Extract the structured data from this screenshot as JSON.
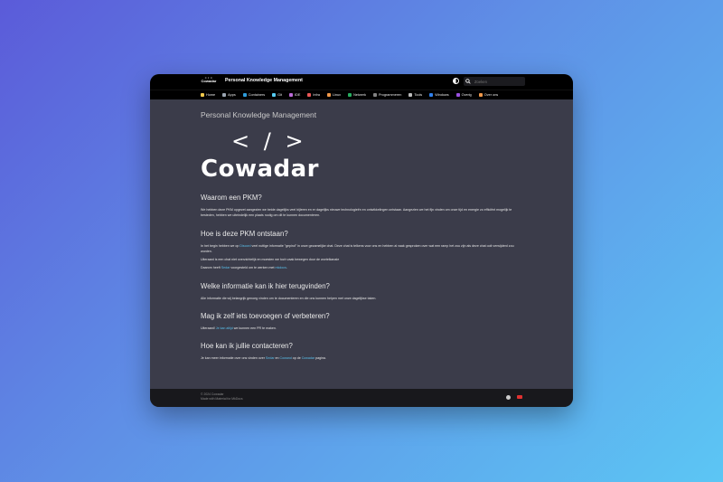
{
  "header": {
    "logo_code": "< / >",
    "logo_text": "Cowadar",
    "site_title": "Personal Knowledge Management",
    "search_placeholder": "Zoeken"
  },
  "nav": {
    "items": [
      {
        "label": "Home",
        "color": "#f2c94c"
      },
      {
        "label": "Apps",
        "color": "#9aa5b1"
      },
      {
        "label": "Containers",
        "color": "#2d9cdb"
      },
      {
        "label": "Git",
        "color": "#56ccf2"
      },
      {
        "label": "IDE",
        "color": "#bb6bd9"
      },
      {
        "label": "Infra",
        "color": "#eb5757"
      },
      {
        "label": "Linux",
        "color": "#f2994a"
      },
      {
        "label": "Netwerk",
        "color": "#27ae60"
      },
      {
        "label": "Programmeren",
        "color": "#828282"
      },
      {
        "label": "Tools",
        "color": "#bdbdbd"
      },
      {
        "label": "Windows",
        "color": "#2f80ed"
      },
      {
        "label": "Overig",
        "color": "#9b51e0"
      },
      {
        "label": "Over ons",
        "color": "#f2994a"
      }
    ]
  },
  "main": {
    "page_title": "Personal Knowledge Management",
    "logo_brackets": "< / >",
    "logo_word": "Cowadar",
    "s1_title": "Waarom een PKM?",
    "s1_p1": "We hebben deze PKM opgezet aangezien we beide dagelijks veel bijleren en er dagelijks nieuwe technologieën en ontwikkelingen ontstaan. Aangezien we het fijn vinden om onze tijd en energie zo efficiënt mogelijk te besteden, hebben we uiteindelijk een plaats nodig om dit te kunnen documenteren.",
    "s2_title": "Hoe is deze PKM ontstaan?",
    "s2_p1_a": "In het begin hebben we op ",
    "s2_p1_link": "Discord",
    "s2_p1_b": " veel nuttige informatie \"gepind\" in onze gezamelijke chat. Deze chat is telkens voor ons en hebben al vaak gesproken over wat een ramp het zou zijn als deze chat ooit verwijderd zou worden.",
    "s2_p2": "Uiteraard is een chat niet overzichtelijk en moesten we toch vaak bewegen door de wortelkanale",
    "s2_p3_a": "Daarom heeft ",
    "s2_p3_link1": "Sedar",
    "s2_p3_b": " voorgesteld om te werken met ",
    "s2_p3_link2": "mkdocs",
    "s2_p3_c": ".",
    "s3_title": "Welke informatie kan ik hier terugvinden?",
    "s3_p1": "Alle informatie die wij belangrijk genoeg vinden om te documenteren en die ons kunnen helpen met onze dagelijkse taken.",
    "s4_title": "Mag ik zelf iets toevoegen of verbeteren?",
    "s4_p1_a": "Uiteraard! ",
    "s4_p1_link": "Je kan altijd",
    "s4_p1_b": " we kunnen een PR te maken.",
    "s5_title": "Hoe kan ik jullie contacteren?",
    "s5_p1_a": "Je kan meer informatie over ons vinden over ",
    "s5_p1_link1": "Sedar",
    "s5_p1_b": " en ",
    "s5_p1_link2": "Cowand",
    "s5_p1_c": " op de ",
    "s5_p1_link3": "Cowadar",
    "s5_p1_d": " pagina."
  },
  "footer": {
    "copyright": "© 2024 Cowadar",
    "made_with": "Made with Material for MkDocs"
  }
}
